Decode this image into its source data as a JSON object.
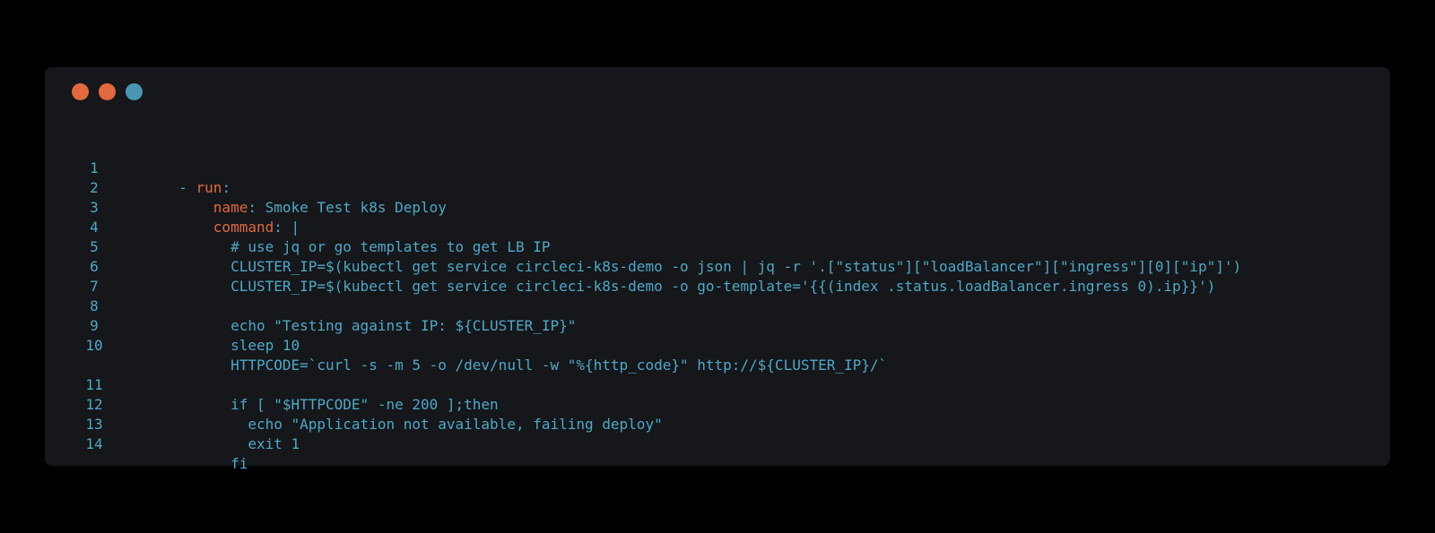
{
  "window": {
    "controls": [
      {
        "name": "close",
        "color": "#e2683f"
      },
      {
        "name": "minimize",
        "color": "#e2683f"
      },
      {
        "name": "maximize",
        "color": "#4a97b3"
      }
    ]
  },
  "code": {
    "lines": [
      {
        "number": "1",
        "indent": "  ",
        "dash": "- ",
        "key": "run",
        "rest": ":"
      },
      {
        "number": "2",
        "indent": "      ",
        "key": "name",
        "rest": ": Smoke Test k8s Deploy"
      },
      {
        "number": "3",
        "indent": "      ",
        "key": "command",
        "rest": ": |"
      },
      {
        "number": "4",
        "text": "        # use jq or go templates to get LB IP"
      },
      {
        "number": "5",
        "text": "        CLUSTER_IP=$(kubectl get service circleci-k8s-demo -o json | jq -r '.[\"status\"][\"loadBalancer\"][\"ingress\"][0][\"ip\"]')"
      },
      {
        "number": "6",
        "text": "        CLUSTER_IP=$(kubectl get service circleci-k8s-demo -o go-template='{{(index .status.loadBalancer.ingress 0).ip}}')"
      },
      {
        "number": "7",
        "text": ""
      },
      {
        "number": "8",
        "text": "        echo \"Testing against IP: ${CLUSTER_IP}\""
      },
      {
        "number": "9",
        "text": "        sleep 10"
      },
      {
        "number": "10",
        "text": "        HTTPCODE=`curl -s -m 5 -o /dev/null -w \"%{http_code}\" http://${CLUSTER_IP}/`"
      },
      {
        "number": "11",
        "text": "        if [ \"$HTTPCODE\" -ne 200 ];then"
      },
      {
        "number": "12",
        "text": "          echo \"Application not available, failing deploy\""
      },
      {
        "number": "13",
        "text": "          exit 1"
      },
      {
        "number": "14",
        "text": "        fi"
      }
    ]
  },
  "colors": {
    "background": "#000000",
    "window": "#15171a",
    "text": "#4fa8c7",
    "key": "#e2683f"
  }
}
